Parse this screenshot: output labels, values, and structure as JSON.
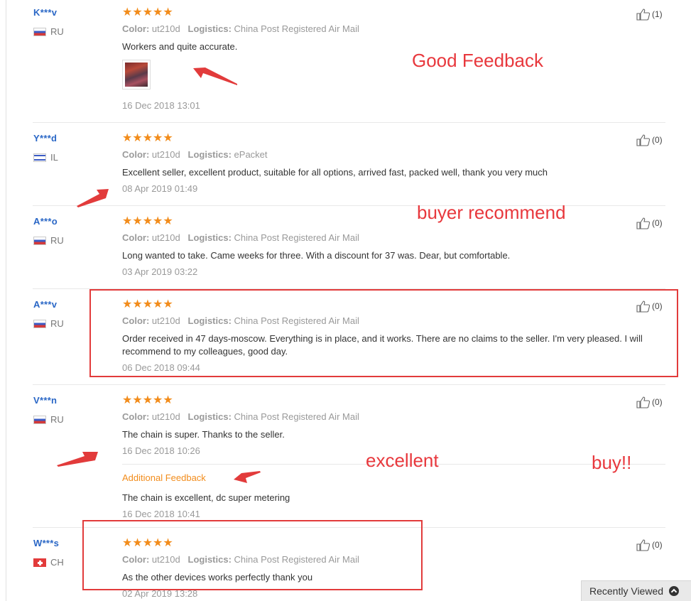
{
  "labels": {
    "color": "Color:",
    "logistics": "Logistics:"
  },
  "stars": "★★★★★",
  "reviews": [
    {
      "buyer": "K***v",
      "country": "RU",
      "flag": "ru",
      "color": "ut210d",
      "logistics": "China Post Registered Air Mail",
      "text": "Workers and quite accurate.",
      "date": "16 Dec 2018 13:01",
      "helpful": "(1)",
      "has_photo": true
    },
    {
      "buyer": "Y***d",
      "country": "IL",
      "flag": "il",
      "color": "ut210d",
      "logistics": "ePacket",
      "text": "Excellent seller, excellent product, suitable for all options, arrived fast, packed well, thank you very much",
      "date": "08 Apr 2019 01:49",
      "helpful": "(0)"
    },
    {
      "buyer": "A***o",
      "country": "RU",
      "flag": "ru",
      "color": "ut210d",
      "logistics": "China Post Registered Air Mail",
      "text": "Long wanted to take. Came weeks for three. With a discount for 37 was. Dear, but comfortable.",
      "date": "03 Apr 2019 03:22",
      "helpful": "(0)"
    },
    {
      "buyer": "A***v",
      "country": "RU",
      "flag": "ru",
      "color": "ut210d",
      "logistics": "China Post Registered Air Mail",
      "text": "Order received in 47 days-moscow. Everything is in place, and it works. There are no claims to the seller. I'm very pleased. I will recommend to my colleagues, good day.",
      "date": "06 Dec 2018 09:44",
      "helpful": "(0)"
    },
    {
      "buyer": "V***n",
      "country": "RU",
      "flag": "ru",
      "color": "ut210d",
      "logistics": "China Post Registered Air Mail",
      "text": "The chain is super. Thanks to the seller.",
      "date": "16 Dec 2018 10:26",
      "helpful": "(0)",
      "additional": {
        "label": "Additional Feedback",
        "text": "The chain is excellent, dc super metering",
        "date": "16 Dec 2018 10:41"
      }
    },
    {
      "buyer": "W***s",
      "country": "CH",
      "flag": "ch",
      "color": "ut210d",
      "logistics": "China Post Registered Air Mail",
      "text": "As the other devices works perfectly thank you",
      "date": "02 Apr 2019 13:28",
      "helpful": "(0)"
    }
  ],
  "annotations": {
    "good_feedback": "Good Feedback",
    "buyer_recommend": "buyer recommend",
    "excellent": "excellent",
    "buy": "buy!!"
  },
  "colors": {
    "accent": "#f28c1b",
    "buyer_link": "#2a67c6",
    "annotation_red": "#e8383d"
  },
  "recently_viewed": {
    "label": "Recently Viewed",
    "icon": "chevron-up-circle-icon"
  }
}
